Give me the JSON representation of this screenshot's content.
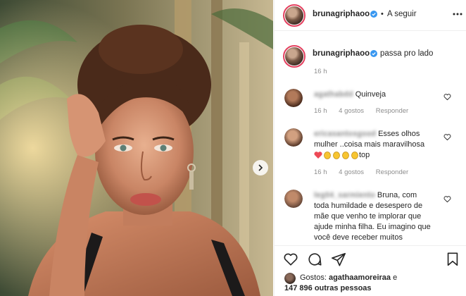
{
  "post": {
    "username": "brunagriphaoo",
    "separator": "•",
    "follow_label": "A seguir",
    "caption": "passa pro lado",
    "caption_time": "16 h"
  },
  "comments": [
    {
      "username": "agathabdd",
      "text": "Quinveja",
      "time": "16 h",
      "likes": "4 gostos",
      "reply_label": "Responder"
    },
    {
      "username": "ericasantosgood",
      "text_line1": "Esses olhos",
      "text_line2": "mulher ..coisa mais maravilhosa",
      "text_after_emoji": "top",
      "emoji": [
        "heart",
        "clap",
        "clap",
        "clap",
        "clap"
      ],
      "time": "16 h",
      "likes": "4 gostos",
      "reply_label": "Responder"
    },
    {
      "username": "leg04_sarmiento",
      "text_line1": "Bruna, com",
      "text_line2": "toda humildade e desespero de",
      "text_line3": "mãe que venho te implorar que",
      "text_line4": "ajude minha filha. Eu imagino que",
      "text_line5": "você deve receber muitos"
    }
  ],
  "likes": {
    "prefix": "Gostos:",
    "user": "agathaamoreiraa",
    "conj": "e",
    "others": "147 896 outras pessoas"
  },
  "icons": [
    "verified-badge-icon",
    "more-options-icon",
    "heart-icon",
    "comment-icon",
    "share-icon",
    "bookmark-icon",
    "next-arrow-icon"
  ],
  "colors": {
    "verified": "#3897f0",
    "heart_red": "#ed4956",
    "meta": "#8e8e8e",
    "border": "#efefef"
  }
}
